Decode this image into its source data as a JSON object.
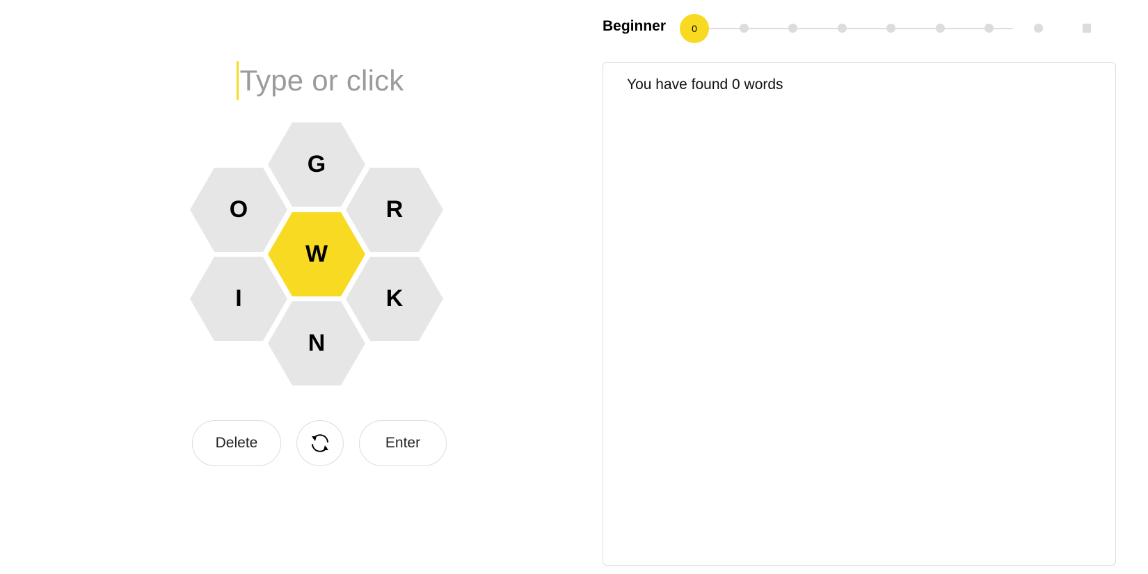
{
  "input": {
    "placeholder": "Type or click"
  },
  "hive": {
    "center_letter": "W",
    "outer_letters": [
      "G",
      "R",
      "K",
      "N",
      "I",
      "O"
    ],
    "center_color": "#f7da21",
    "outer_color": "#e6e6e6"
  },
  "controls": {
    "delete_label": "Delete",
    "shuffle_icon": "shuffle-icon",
    "enter_label": "Enter"
  },
  "progress": {
    "rank": "Beginner",
    "score": "0",
    "total_steps": 9,
    "current_step": 0,
    "accent_color": "#f7da21"
  },
  "wordlist": {
    "summary": "You have found 0 words"
  }
}
